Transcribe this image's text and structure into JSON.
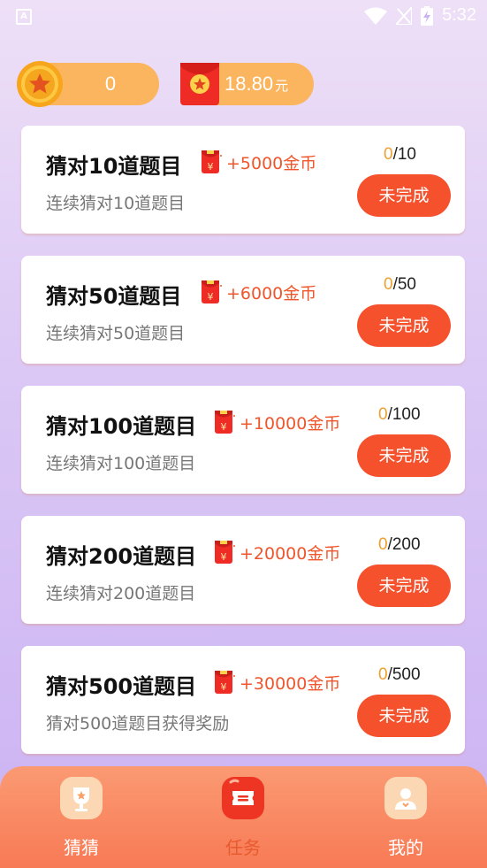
{
  "status_bar": {
    "time": "5:32",
    "left_icon": "A"
  },
  "header": {
    "coins": "0",
    "cash": "18.80",
    "cash_unit": "元"
  },
  "tasks": [
    {
      "title": "猜对10道题目",
      "reward": "+5000金币",
      "desc": "连续猜对10道题目",
      "done": "0",
      "total": "/10",
      "status": "未完成"
    },
    {
      "title": "猜对50道题目",
      "reward": "+6000金币",
      "desc": "连续猜对50道题目",
      "done": "0",
      "total": "/50",
      "status": "未完成"
    },
    {
      "title": "猜对100道题目",
      "reward": "+10000金币",
      "desc": "连续猜对100道题目",
      "done": "0",
      "total": "/100",
      "status": "未完成"
    },
    {
      "title": "猜对200道题目",
      "reward": "+20000金币",
      "desc": "连续猜对200道题目",
      "done": "0",
      "total": "/200",
      "status": "未完成"
    },
    {
      "title": "猜对500道题目",
      "reward": "+30000金币",
      "desc": "猜对500道题目获得奖励",
      "done": "0",
      "total": "/500",
      "status": "未完成"
    }
  ],
  "nav": {
    "items": [
      {
        "label": "猜猜",
        "icon": "trophy-icon"
      },
      {
        "label": "任务",
        "icon": "ticket-icon",
        "active": true
      },
      {
        "label": "我的",
        "icon": "user-icon"
      }
    ]
  },
  "colors": {
    "accent": "#f5512d",
    "pill": "#fbb55f",
    "progress_done": "#f0a030",
    "reward_text": "#f0562c",
    "nav_bg": "#f77a55"
  }
}
